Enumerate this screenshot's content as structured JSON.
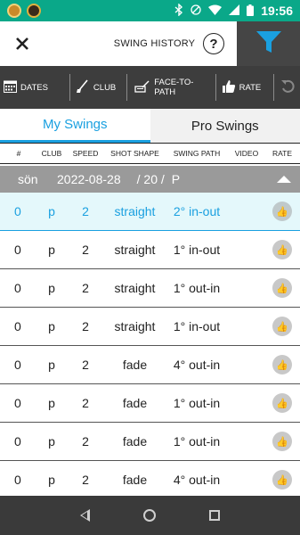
{
  "status_bar": {
    "time": "19:56",
    "icons": [
      "bluetooth-icon",
      "signal-off-icon",
      "wifi-icon",
      "cellular-icon",
      "battery-icon"
    ]
  },
  "header": {
    "title": "SWING HISTORY",
    "close_icon": "close-icon",
    "help_label": "?",
    "filter_icon": "funnel-icon"
  },
  "toolbar": {
    "items": [
      {
        "label": "DATES",
        "icon": "calendar-icon"
      },
      {
        "label": "CLUB",
        "icon": "golf-club-icon"
      },
      {
        "label": "FACE-TO-PATH",
        "icon": "club-face-icon"
      },
      {
        "label": "RATE",
        "icon": "thumbs-up-icon"
      }
    ],
    "undo_icon": "undo-icon"
  },
  "tabs": [
    {
      "label": "My Swings",
      "active": true
    },
    {
      "label": "Pro Swings",
      "active": false
    }
  ],
  "columns": [
    "#",
    "CLUB",
    "SPEED",
    "SHOT SHAPE",
    "SWING PATH",
    "VIDEO",
    "RATE"
  ],
  "session": {
    "day": "sön",
    "date": "2022-08-28",
    "count": "/ 20 /",
    "club": "P"
  },
  "rows": [
    {
      "num": "0",
      "club": "p",
      "speed": "2",
      "shape": "straight",
      "path": "2° in-out",
      "selected": true
    },
    {
      "num": "0",
      "club": "p",
      "speed": "2",
      "shape": "straight",
      "path": "1° in-out",
      "selected": false
    },
    {
      "num": "0",
      "club": "p",
      "speed": "2",
      "shape": "straight",
      "path": "1° out-in",
      "selected": false
    },
    {
      "num": "0",
      "club": "p",
      "speed": "2",
      "shape": "straight",
      "path": "1° in-out",
      "selected": false
    },
    {
      "num": "0",
      "club": "p",
      "speed": "2",
      "shape": "fade",
      "path": "4° out-in",
      "selected": false
    },
    {
      "num": "0",
      "club": "p",
      "speed": "2",
      "shape": "fade",
      "path": "1° out-in",
      "selected": false
    },
    {
      "num": "0",
      "club": "p",
      "speed": "2",
      "shape": "fade",
      "path": "1° out-in",
      "selected": false
    },
    {
      "num": "0",
      "club": "p",
      "speed": "2",
      "shape": "fade",
      "path": "4° out-in",
      "selected": false
    }
  ],
  "colors": {
    "status_bar": "#0aa889",
    "accent": "#1aa0e0",
    "toolbar": "#3d3d3d",
    "selected_row": "#e4f8fb",
    "session_header": "#9a9a9a"
  }
}
